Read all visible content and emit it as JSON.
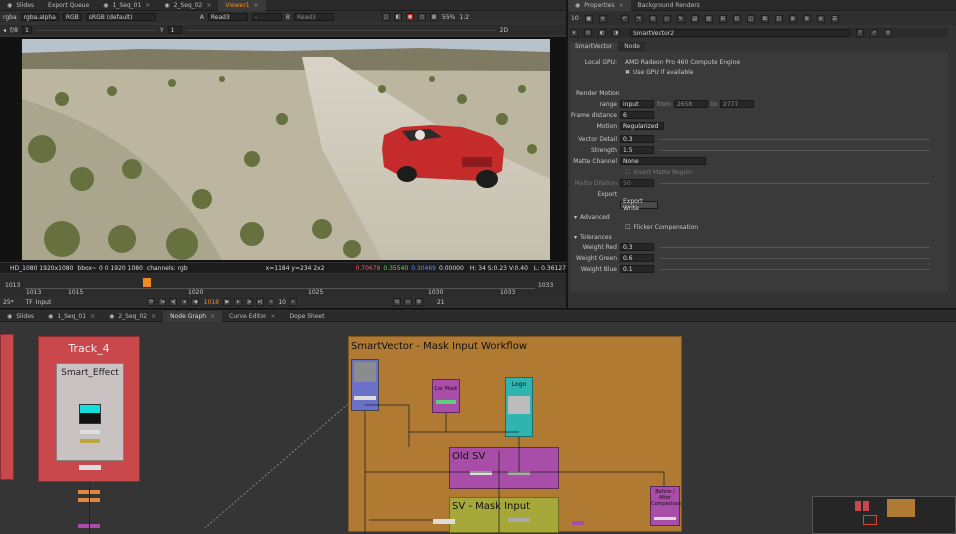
{
  "top_tabs": [
    "Slides",
    "Export Queue",
    "1_Seq_01",
    "2_Seq_02",
    "Viewer1"
  ],
  "viewer_toolbar": {
    "channels": "rgba",
    "alpha": "rgba.alpha",
    "colorspace": "RGB",
    "display": "sRGB (default)",
    "a_label": "A",
    "a_input": "Read3",
    "dash": "-",
    "b_label": "B",
    "b_input": "Read3",
    "zoom": "55%",
    "ratio": "1:2"
  },
  "viewer_toolbar2": {
    "fstop": "f/8",
    "frame": "1",
    "y_label": "Y",
    "y_value": "1",
    "mode": "2D"
  },
  "image_info": {
    "format": "HD_1080 1920x1080",
    "bbox": "bbox~ 0 0 1920 1080",
    "channels": "channels: rgb",
    "coords": "x=1184 y=234 2x2",
    "r": "0.70678",
    "g": "0.35540",
    "b": "0.30469",
    "a": "0.00000",
    "hsv": "H: 34 S:0.23 V:0.40",
    "lum": "L: 0.36127"
  },
  "timeline": {
    "start": "1013",
    "ticks": [
      "1013",
      "1015",
      "1020",
      "1025",
      "1030",
      "1033"
    ],
    "playhead": "1018",
    "end": "1033",
    "fps": "25*",
    "tf": "TF",
    "mode": "Input",
    "step": "10",
    "frame": "1018",
    "last": "21"
  },
  "props_tabs": [
    "Properties",
    "Background Renders"
  ],
  "props_header": {
    "count": "10",
    "node_name": "SmartVector2"
  },
  "props_subtabs": [
    "SmartVector",
    "Node"
  ],
  "props": {
    "local_gpu_label": "Local GPU:",
    "local_gpu_value": "AMD Radeon Pro 460 Compute Engine",
    "use_gpu": "Use GPU if available",
    "render_motion": "Render Motion",
    "range_label": "range",
    "range_value": "input",
    "from_label": "from",
    "from_value": "2658",
    "to_label": "to",
    "to_value": "2777",
    "frame_distance_label": "Frame distance",
    "frame_distance_value": "6",
    "motion_label": "Motion",
    "motion_value": "Regularized",
    "vector_detail_label": "Vector Detail",
    "vector_detail_value": "0.3",
    "strength_label": "Strength",
    "strength_value": "1.5",
    "matte_channel_label": "Matte Channel",
    "matte_channel_value": "None",
    "invert_matte": "Invert Matte Region",
    "matte_dilation_label": "Matte Dilation",
    "matte_dilation_value": "50",
    "export_label": "Export",
    "export_button": "Export Write",
    "advanced": "Advanced",
    "flicker": "Flicker Compensation",
    "tolerances": "Tolerances",
    "weight_red_label": "Weight Red",
    "weight_red_value": "0.3",
    "weight_green_label": "Weight Green",
    "weight_green_value": "0.6",
    "weight_blue_label": "Weight Blue",
    "weight_blue_value": "0.1"
  },
  "bottom_tabs": [
    "Slides",
    "1_Seq_01",
    "2_Seq_02",
    "Node Graph",
    "Curve Editor",
    "Dope Sheet"
  ],
  "graph": {
    "backdrop_track": "Track_4",
    "inner_label": "Smart_Effect",
    "backdrop_sv": "SmartVector - Mask Input Workflow",
    "car_mask": "Car Mask",
    "logo": "Logo",
    "old_sv": "Old SV",
    "sv_mask": "SV - Mask Input",
    "before_after": "Before / After Comparison"
  },
  "colors": {
    "accent": "#f08b1f",
    "track_backdrop": "#c8484b",
    "sv_backdrop": "#b07a32",
    "old_sv": "#a94ea8",
    "sv_mask": "#a6a83a"
  }
}
